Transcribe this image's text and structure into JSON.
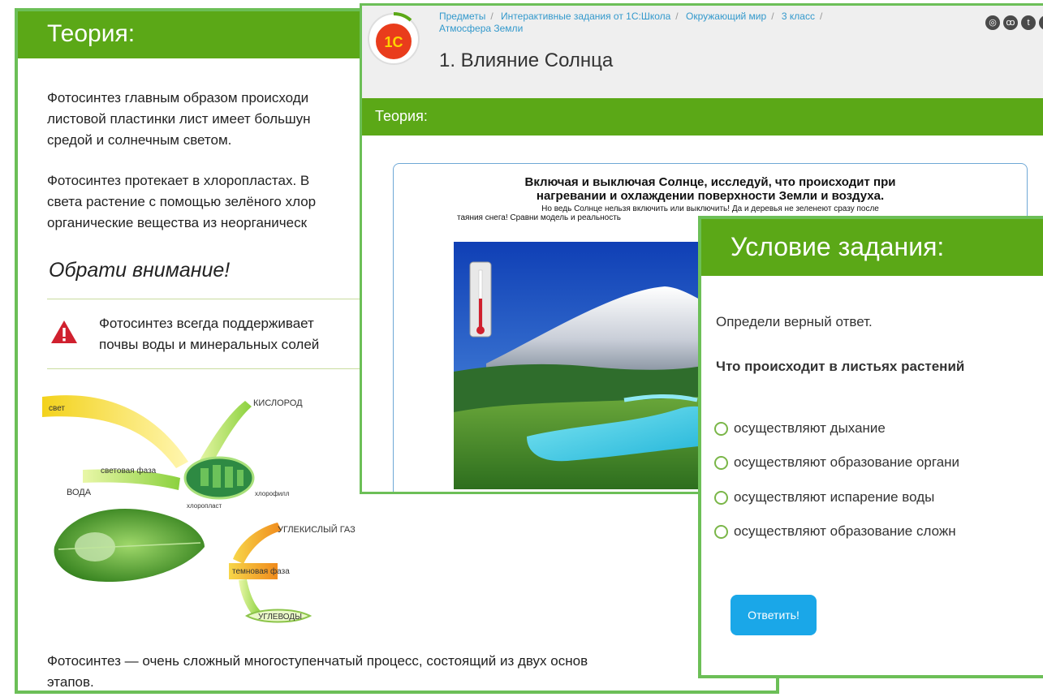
{
  "theory_panel": {
    "header": "Теория:",
    "para1_line1": "Фотосинтез главным образом происходи",
    "para1_line2": "листовой пластинки лист имеет большун",
    "para1_line3": "средой и солнечным светом.",
    "para2_line1": "Фотосинтез протекает в хлоропластах. В",
    "para2_line2": "света растение с помощью зелёного хлор",
    "para2_line3": "органические вещества из неорганическ",
    "notice_title": "Обрати внимание!",
    "warning_line1": "Фотосинтез всегда поддерживает",
    "warning_line2": "почвы воды и минеральных солей",
    "diagram_labels": {
      "light": "свет",
      "oxygen": "КИСЛОРОД",
      "light_phase": "световая фаза",
      "water": "ВОДА",
      "chloroplast": "хлоропласт",
      "chlorophyll": "хлорофилл",
      "co2": "УГЛЕКИСЛЫЙ ГАЗ",
      "dark_phase": "темновая фаза",
      "carbs": "УГЛЕВОДЫ"
    },
    "footer_line1": "Фотосинтез — очень сложный многоступенчатый процесс, состоящий из двух основ",
    "footer_line2": "этапов."
  },
  "lesson_panel": {
    "breadcrumbs": [
      "Предметы",
      "Интерактивные задания от 1С:Школа",
      "Окружающий мир",
      "3 класс",
      "Атмосфера Земли"
    ],
    "logo_text": "1С",
    "title": "1. Влияние Солнца",
    "section": "Теория:",
    "sim_title_line1": "Включая и выключая Солнце, исследуй, что происходит при",
    "sim_title_line2": "нагревании и охлаждении поверхности Земли и воздуха.",
    "sim_sub_line1": "Но ведь Солнце нельзя включить или выключить! Да и деревья не зеленеют сразу после",
    "sim_sub_line2": "таяния снега! Сравни модель и реальность",
    "social_icons": [
      "instagram-icon",
      "odnoklassniki-icon",
      "twitter-icon",
      "other-icon"
    ]
  },
  "task_panel": {
    "header": "Условие задания:",
    "instruction": "Определи верный ответ.",
    "question": "Что происходит в листьях растений",
    "options": [
      "осуществляют дыхание",
      "осуществляют образование органи",
      "осуществляют испарение воды",
      "осуществляют образование сложн"
    ],
    "answer_button": "Ответить!"
  },
  "colors": {
    "header_green": "#5ba817",
    "border_green": "#6cbf57",
    "link_blue": "#3399cc",
    "button_blue": "#1aa7e8",
    "warning_red": "#d0202e"
  }
}
